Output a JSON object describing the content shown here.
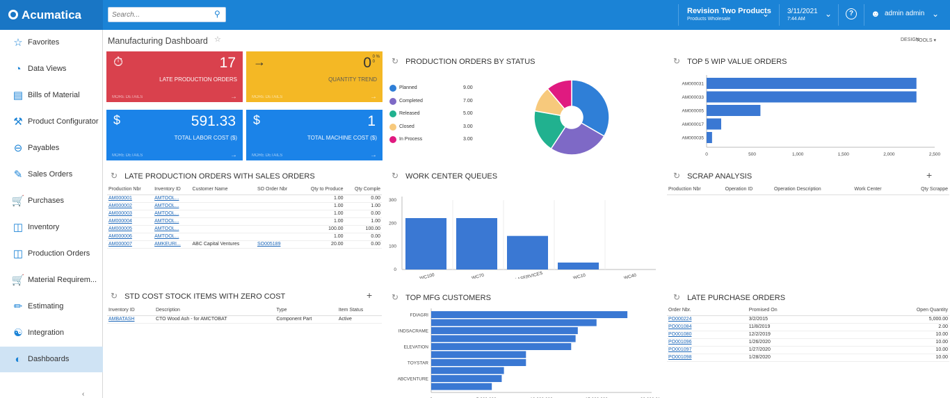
{
  "app": {
    "name": "Acumatica"
  },
  "search": {
    "placeholder": "Search..."
  },
  "company": {
    "name": "Revision Two Products",
    "branch": "Products Wholesale"
  },
  "datetime": {
    "date": "3/11/2021",
    "time": "7:44 AM"
  },
  "user": {
    "name": "admin admin"
  },
  "sidebar": {
    "items": [
      {
        "label": "Favorites",
        "icon": "star-icon"
      },
      {
        "label": "Data Views",
        "icon": "pie-icon"
      },
      {
        "label": "Bills of Material",
        "icon": "document-icon"
      },
      {
        "label": "Product Configurator",
        "icon": "wrench-icon"
      },
      {
        "label": "Payables",
        "icon": "minus-circle-icon"
      },
      {
        "label": "Sales Orders",
        "icon": "edit-icon"
      },
      {
        "label": "Purchases",
        "icon": "cart-icon"
      },
      {
        "label": "Inventory",
        "icon": "boxes-icon"
      },
      {
        "label": "Production Orders",
        "icon": "boxes-icon"
      },
      {
        "label": "Material Requirem...",
        "icon": "cart-icon"
      },
      {
        "label": "Estimating",
        "icon": "pencil-icon"
      },
      {
        "label": "Integration",
        "icon": "hierarchy-icon"
      },
      {
        "label": "Dashboards",
        "icon": "dashboard-icon"
      }
    ],
    "active": "Dashboards",
    "footer": "‹"
  },
  "page": {
    "title": "Manufacturing Dashboard",
    "design_label": "DESIGN",
    "tools_label": "TOOLS ▾"
  },
  "tiles": {
    "late_orders": {
      "value": "17",
      "label": "LATE PRODUCTION ORDERS",
      "more": "MORE DETAILS",
      "color": "#d9414d"
    },
    "quantity_trend": {
      "value": "0",
      "sub1": "0 %",
      "sub2": "0",
      "label": "QUANTITY TREND",
      "more": "MORE DETAILS",
      "color": "#f4b825"
    },
    "labor_cost": {
      "value": "591.33",
      "label": "TOTAL LABOR COST ($)",
      "more": "MORE DETAILS",
      "color": "#1b83e8"
    },
    "machine_cost": {
      "value": "1",
      "label": "TOTAL MACHINE COST ($)",
      "more": "MORE DETAILS",
      "color": "#1b83e8"
    }
  },
  "status_widget": {
    "title": "PRODUCTION ORDERS BY STATUS",
    "legend": [
      {
        "label": "Planned",
        "value": "9.00",
        "color": "#2f7fd7"
      },
      {
        "label": "Completed",
        "value": "7.00",
        "color": "#7e69c6"
      },
      {
        "label": "Released",
        "value": "5.00",
        "color": "#21b18f"
      },
      {
        "label": "Closed",
        "value": "3.00",
        "color": "#f7c97c"
      },
      {
        "label": "In Process",
        "value": "3.00",
        "color": "#e01a80"
      }
    ]
  },
  "wip_widget": {
    "title": "TOP 5 WIP VALUE ORDERS",
    "chart_data": {
      "type": "bar",
      "orientation": "horizontal",
      "categories": [
        "AM000031",
        "AM000033",
        "AM000005",
        "AM000017",
        "AM000035"
      ],
      "values": [
        2300,
        2300,
        590,
        160,
        60
      ],
      "xlim": [
        0,
        2500
      ],
      "xticks": [
        "0",
        "500",
        "1,000",
        "1,500",
        "2,000",
        "2,500"
      ],
      "color": "#3a78d3"
    }
  },
  "late_so_widget": {
    "title": "LATE PRODUCTION ORDERS WITH SALES ORDERS",
    "headers": [
      "Production Nbr",
      "Inventory ID",
      "Customer Name",
      "SO Order Nbr",
      "Qty to Produce",
      "Qty Comple"
    ],
    "rows": [
      [
        "AM000001",
        "AMTOOL...",
        "",
        "",
        "1.00",
        "0.00"
      ],
      [
        "AM000002",
        "AMTOOL...",
        "",
        "",
        "1.00",
        "1.00"
      ],
      [
        "AM000003",
        "AMTOOL...",
        "",
        "",
        "1.00",
        "0.00"
      ],
      [
        "AM000004",
        "AMTOOL...",
        "",
        "",
        "1.00",
        "1.00"
      ],
      [
        "AM000005",
        "AMTOOL...",
        "",
        "",
        "100.00",
        "100.00"
      ],
      [
        "AM000006",
        "AMTOOL...",
        "",
        "",
        "1.00",
        "0.00"
      ],
      [
        "AM000007",
        "AMKEURI...",
        "ABC Capital Ventures",
        "SO005189",
        "20.00",
        "0.00"
      ]
    ]
  },
  "wc_widget": {
    "title": "WORK CENTER QUEUES",
    "chart_data": {
      "type": "bar",
      "categories": [
        "WC100",
        "WC70",
        "AASERVICES",
        "WC10",
        "WC40"
      ],
      "values": [
        222,
        222,
        145,
        30,
        0
      ],
      "ylim": [
        0,
        300
      ],
      "yticks": [
        "0",
        "100",
        "200",
        "300"
      ],
      "color": "#3a78d3"
    }
  },
  "scrap_widget": {
    "title": "SCRAP ANALYSIS",
    "headers": [
      "Production Nbr",
      "Operation ID",
      "Operation Description",
      "Work Center",
      "Qty Scrappe"
    ]
  },
  "std_widget": {
    "title": "STD COST STOCK ITEMS WITH ZERO COST",
    "headers": [
      "Inventory ID",
      "Description",
      "Type",
      "Item Status"
    ],
    "rows": [
      [
        "AMBATASH",
        "CTO Wood Ash - for AMCTOBAT",
        "Component Part",
        "Active"
      ]
    ]
  },
  "cust_widget": {
    "title": "TOP MFG CUSTOMERS",
    "chart_data": {
      "type": "bar",
      "orientation": "horizontal",
      "categories": [
        "FDIAGRI",
        "",
        "INDSACRAME",
        "",
        "ELEVATION",
        "",
        "TOYSTAR",
        "",
        "ABCVENTURE",
        ""
      ],
      "values": [
        17800000,
        15000000,
        13300000,
        13100000,
        12700000,
        8600000,
        8600000,
        6600000,
        6400000,
        5500000
      ],
      "xlim": [
        0,
        20000000
      ],
      "xticks": [
        "0",
        "5,000,000",
        "10,000,000",
        "15,000,000",
        "20,000,000"
      ],
      "color": "#3a78d3"
    }
  },
  "lpo_widget": {
    "title": "LATE PURCHASE ORDERS",
    "headers": [
      "Order Nbr.",
      "Promised On",
      "Open Quantity"
    ],
    "rows": [
      [
        "PO000224",
        "3/2/2015",
        "5,000.00"
      ],
      [
        "PO001084",
        "11/8/2019",
        "2.00"
      ],
      [
        "PO001080",
        "12/2/2019",
        "10.00"
      ],
      [
        "PO001096",
        "1/26/2020",
        "10.00"
      ],
      [
        "PO001097",
        "1/27/2020",
        "10.00"
      ],
      [
        "PO001098",
        "1/28/2020",
        "10.00"
      ]
    ]
  }
}
